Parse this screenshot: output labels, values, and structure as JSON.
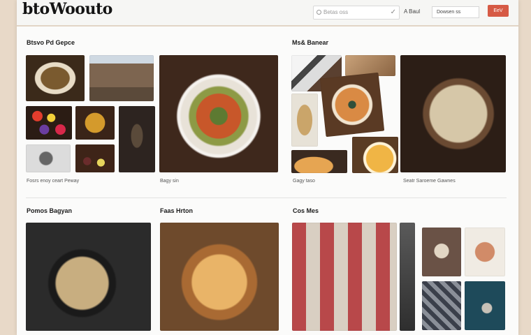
{
  "header": {
    "logo": "btoWoouto",
    "search_placeholder": "Betas oss",
    "nav_link": "A Baul",
    "browse_label": "Dowsen ss",
    "go_label": "EeV"
  },
  "sections": [
    {
      "title": "Btsvo Pd Gepce",
      "caption": "Fosrs enoy ceart Peway"
    },
    {
      "caption": "Bagy sin"
    },
    {
      "title": "Ms& Banear",
      "caption": "Gagy taso"
    },
    {
      "caption": "Seatr Saroeme Gawnes"
    },
    {
      "title": "Pomos Bagyan"
    },
    {
      "title": "Faas Hrton"
    },
    {
      "title": "Cos Mes"
    }
  ],
  "colors": {
    "accent": "#d65a45",
    "background": "#e8d9c8",
    "page": "#fbfbfa"
  }
}
